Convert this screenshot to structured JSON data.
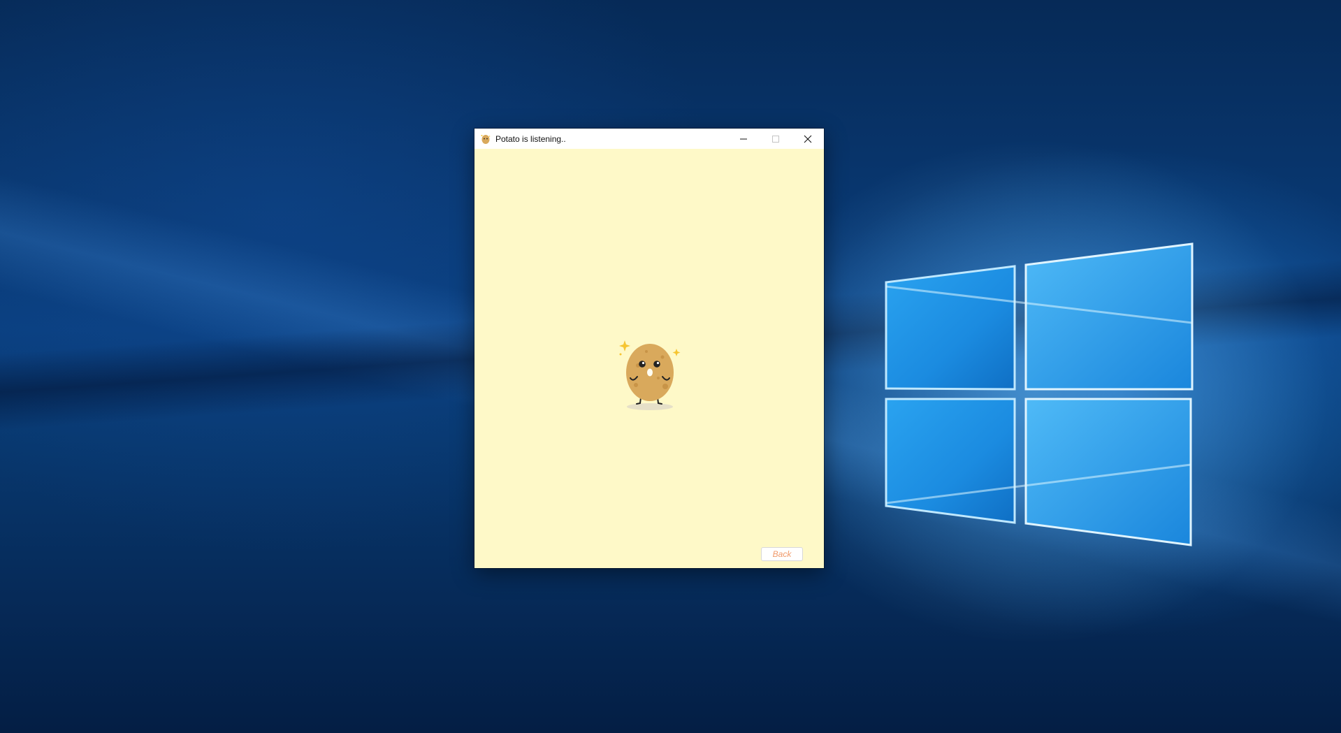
{
  "window": {
    "title": "Potato is listening..",
    "app_icon": "potato-icon",
    "controls": {
      "minimize": "minimize-icon",
      "maximize": "maximize-icon",
      "close": "close-icon"
    }
  },
  "content": {
    "mascot": "potato-mascot",
    "back_label": "Back"
  },
  "colors": {
    "client_background": "#fef9c8",
    "back_text": "#f09a6a",
    "potato_body": "#d9a95c",
    "sparkle": "#f6c531"
  }
}
